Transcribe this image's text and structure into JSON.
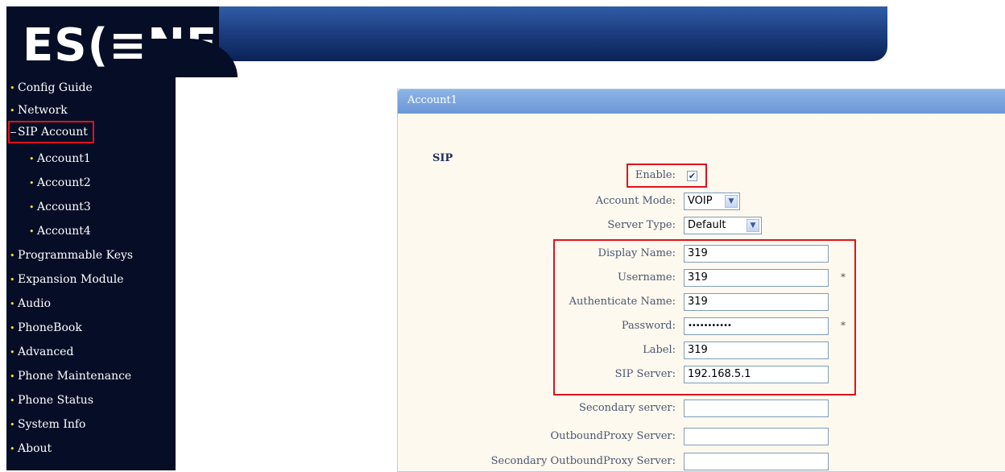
{
  "logo": {
    "text": "ES(≡NE"
  },
  "sidebar": {
    "items": [
      {
        "label": "Config Guide"
      },
      {
        "label": "Network"
      },
      {
        "label": "SIP Account"
      },
      {
        "label": "Account1"
      },
      {
        "label": "Account2"
      },
      {
        "label": "Account3"
      },
      {
        "label": "Account4"
      },
      {
        "label": "Programmable Keys"
      },
      {
        "label": "Expansion Module"
      },
      {
        "label": "Audio"
      },
      {
        "label": "PhoneBook"
      },
      {
        "label": "Advanced"
      },
      {
        "label": "Phone Maintenance"
      },
      {
        "label": "Phone Status"
      },
      {
        "label": "System Info"
      },
      {
        "label": "About"
      }
    ],
    "expanded_marker": "−",
    "bullet": "•"
  },
  "panel": {
    "title": "Account1",
    "section": "SIP",
    "enable": {
      "label": "Enable:",
      "checked": true,
      "check_glyph": "✔"
    },
    "account_mode": {
      "label": "Account Mode:",
      "value": "VOIP"
    },
    "server_type": {
      "label": "Server Type:",
      "value": "Default"
    },
    "display_name": {
      "label": "Display Name:",
      "value": "319"
    },
    "username": {
      "label": "Username:",
      "value": "319",
      "required": "*"
    },
    "authenticate_name": {
      "label": "Authenticate Name:",
      "value": "319"
    },
    "password": {
      "label": "Password:",
      "value": "•••••••••••",
      "required": "*"
    },
    "label_field": {
      "label": "Label:",
      "value": "319"
    },
    "sip_server": {
      "label": "SIP Server:",
      "value": "192.168.5.1"
    },
    "secondary_server": {
      "label": "Secondary server:",
      "value": ""
    },
    "outbound_proxy": {
      "label": "OutboundProxy Server:",
      "value": ""
    },
    "secondary_outbound_proxy": {
      "label": "Secondary OutboundProxy Server:",
      "value": ""
    },
    "dropdown_arrow": "▼"
  },
  "colors": {
    "sidebar_bg": "#050e26",
    "header_blue": "#1d3f82",
    "panel_header": "#7aa4de",
    "highlight_red": "#e0121b"
  }
}
